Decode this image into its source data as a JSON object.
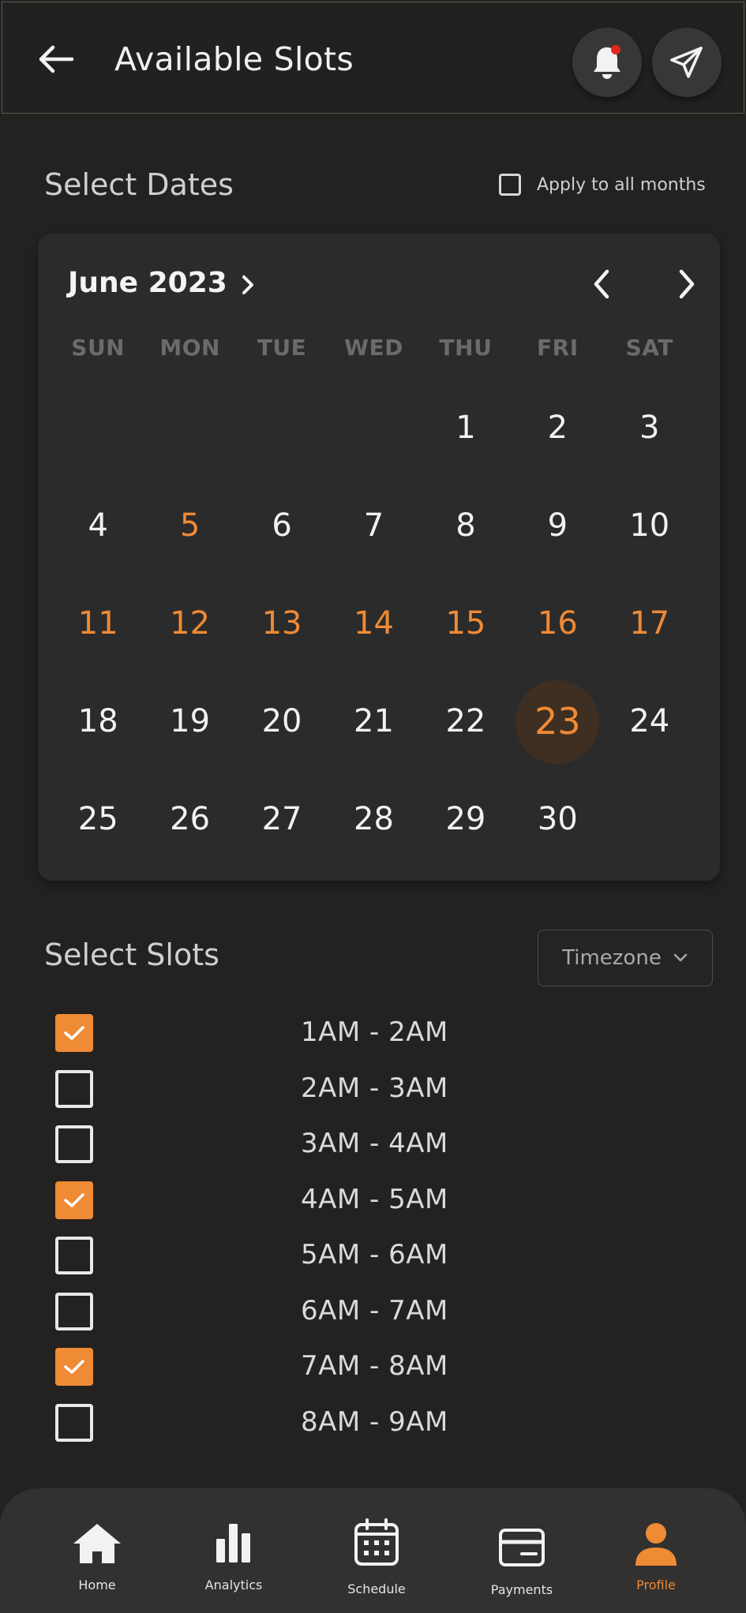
{
  "header": {
    "title": "Available Slots",
    "back_icon": "arrow-left-icon",
    "bell_icon": "bell-icon",
    "send_icon": "send-icon"
  },
  "dates_section": {
    "title": "Select Dates",
    "apply_all_label": "Apply to all months",
    "apply_all_checked": false
  },
  "calendar": {
    "month_label": "June 2023",
    "weekdays": [
      "SUN",
      "MON",
      "TUE",
      "WED",
      "THU",
      "FRI",
      "SAT"
    ],
    "leading_blanks": 4,
    "days": [
      {
        "n": "1",
        "state": "normal"
      },
      {
        "n": "2",
        "state": "normal"
      },
      {
        "n": "3",
        "state": "normal"
      },
      {
        "n": "4",
        "state": "normal"
      },
      {
        "n": "5",
        "state": "highlighted"
      },
      {
        "n": "6",
        "state": "normal"
      },
      {
        "n": "7",
        "state": "normal"
      },
      {
        "n": "8",
        "state": "normal"
      },
      {
        "n": "9",
        "state": "normal"
      },
      {
        "n": "10",
        "state": "normal"
      },
      {
        "n": "11",
        "state": "highlighted"
      },
      {
        "n": "12",
        "state": "highlighted"
      },
      {
        "n": "13",
        "state": "highlighted"
      },
      {
        "n": "14",
        "state": "highlighted"
      },
      {
        "n": "15",
        "state": "highlighted"
      },
      {
        "n": "16",
        "state": "highlighted"
      },
      {
        "n": "17",
        "state": "highlighted"
      },
      {
        "n": "18",
        "state": "normal"
      },
      {
        "n": "19",
        "state": "normal"
      },
      {
        "n": "20",
        "state": "normal"
      },
      {
        "n": "21",
        "state": "normal"
      },
      {
        "n": "22",
        "state": "normal"
      },
      {
        "n": "23",
        "state": "selected"
      },
      {
        "n": "24",
        "state": "normal"
      },
      {
        "n": "25",
        "state": "normal"
      },
      {
        "n": "26",
        "state": "normal"
      },
      {
        "n": "27",
        "state": "normal"
      },
      {
        "n": "28",
        "state": "normal"
      },
      {
        "n": "29",
        "state": "normal"
      },
      {
        "n": "30",
        "state": "normal"
      }
    ]
  },
  "slots_section": {
    "title": "Select Slots",
    "timezone_label": "Timezone",
    "slots": [
      {
        "label": "1AM - 2AM",
        "checked": true
      },
      {
        "label": "2AM - 3AM",
        "checked": false
      },
      {
        "label": "3AM - 4AM",
        "checked": false
      },
      {
        "label": "4AM - 5AM",
        "checked": true
      },
      {
        "label": "5AM - 6AM",
        "checked": false
      },
      {
        "label": "6AM - 7AM",
        "checked": false
      },
      {
        "label": "7AM - 8AM",
        "checked": true
      },
      {
        "label": "8AM - 9AM",
        "checked": false
      }
    ]
  },
  "bottom_nav": {
    "items": [
      {
        "label": "Home",
        "icon": "home-icon",
        "active": false
      },
      {
        "label": "Analytics",
        "icon": "bar-chart-icon",
        "active": false
      },
      {
        "label": "Schedule",
        "icon": "calendar-icon",
        "active": false
      },
      {
        "label": "Payments",
        "icon": "credit-card-icon",
        "active": false
      },
      {
        "label": "Profile",
        "icon": "user-icon",
        "active": true
      }
    ]
  },
  "colors": {
    "accent": "#ef8a35",
    "background": "#242220",
    "card": "#2c2b2b",
    "notification_dot": "#e2271f"
  }
}
